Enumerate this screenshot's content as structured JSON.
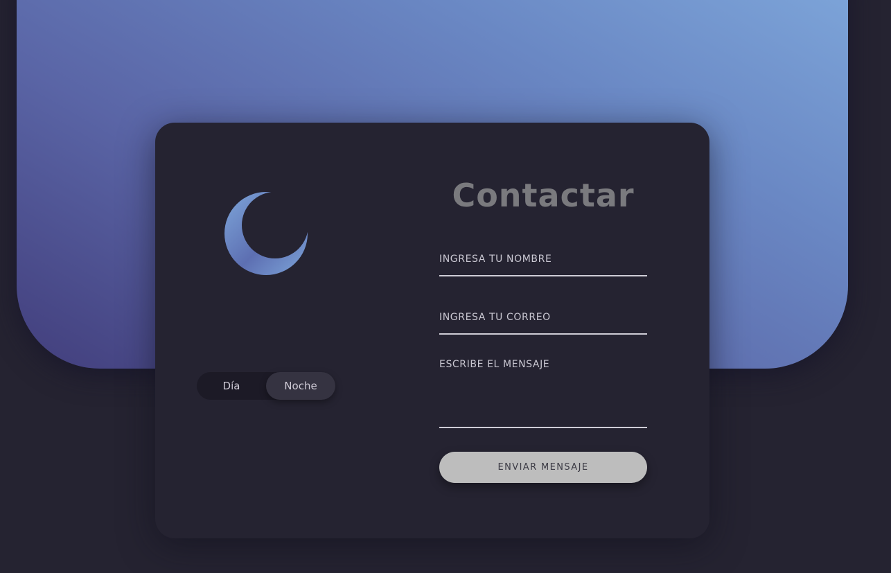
{
  "theme_toggle": {
    "day_label": "Día",
    "night_label": "Noche",
    "selected": "Noche"
  },
  "form": {
    "title": "Contactar",
    "name_placeholder": "INGRESA TU NOMBRE",
    "email_placeholder": "INGRESA TU CORREO",
    "message_placeholder": "ESCRIBE EL MENSAJE",
    "submit_label": "ENVIAR MENSAJE"
  },
  "icons": {
    "theme_icon": "moon-icon"
  },
  "colors": {
    "background": "#252331",
    "gradient_start": "#423e7c",
    "gradient_end": "#7ea6da",
    "button": "#bdbdbd",
    "title": "#7a7a7e"
  }
}
